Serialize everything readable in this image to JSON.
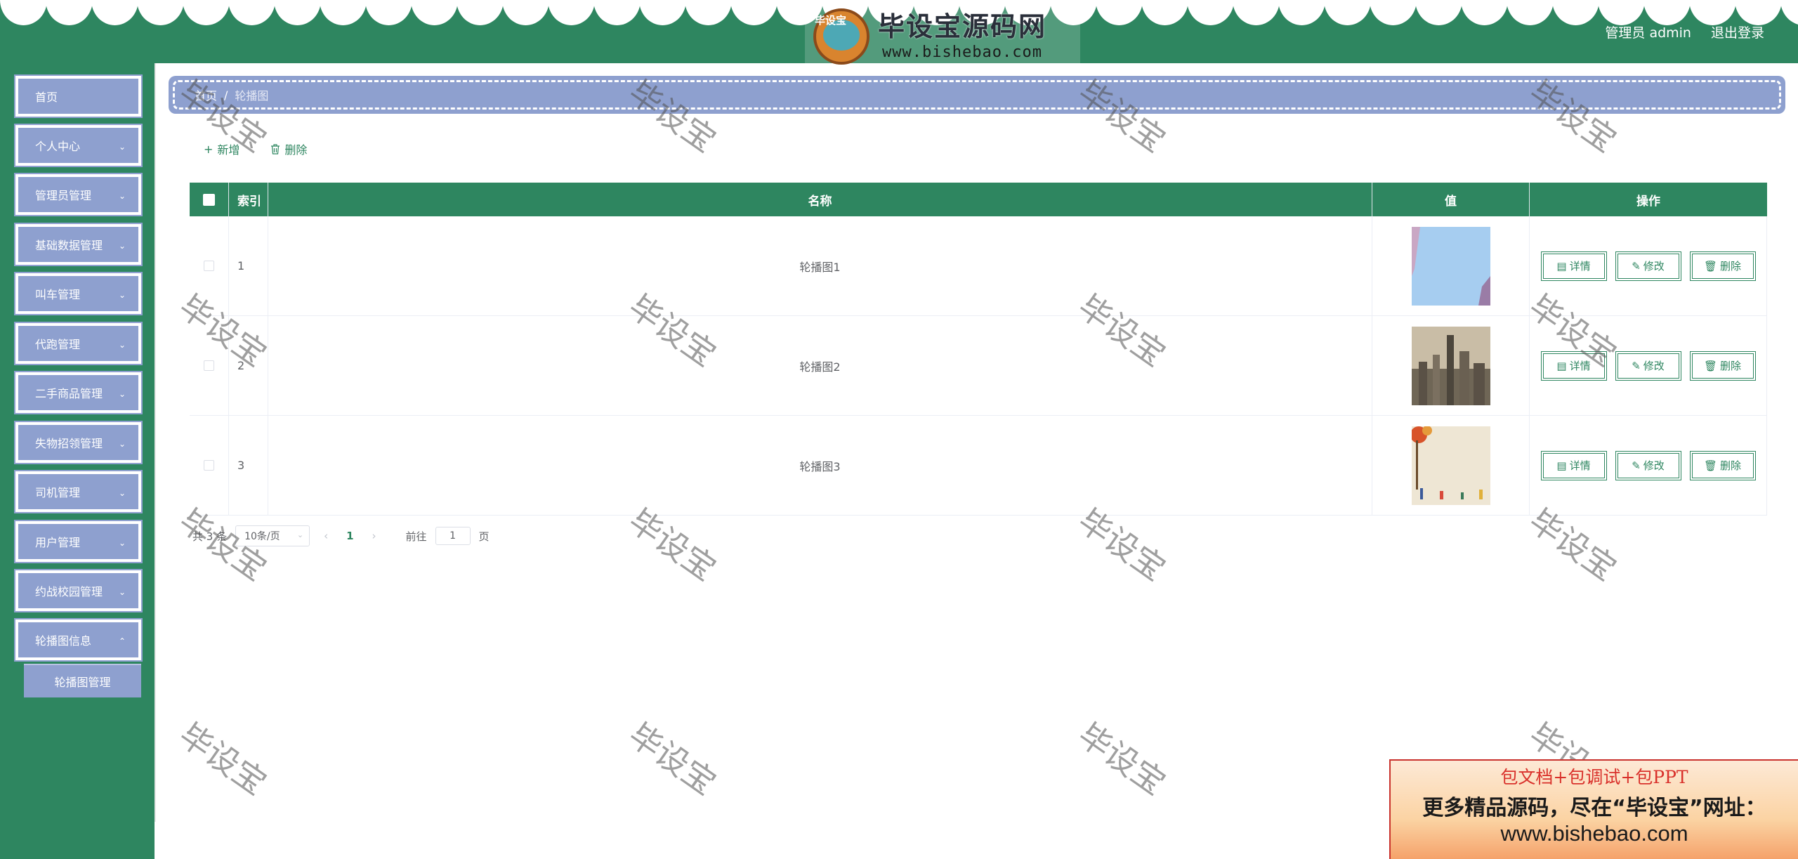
{
  "header": {
    "user_label": "管理员 admin",
    "logout_label": "退出登录",
    "logo_tag": "毕设宝",
    "logo_title": "毕设宝源码网",
    "logo_url": "www.bishebao.com",
    "bg_color": "#2e8660"
  },
  "sidebar": {
    "items": [
      {
        "label": "首页",
        "has_submenu": false
      },
      {
        "label": "个人中心",
        "has_submenu": true
      },
      {
        "label": "管理员管理",
        "has_submenu": true
      },
      {
        "label": "基础数据管理",
        "has_submenu": true
      },
      {
        "label": "叫车管理",
        "has_submenu": true
      },
      {
        "label": "代跑管理",
        "has_submenu": true
      },
      {
        "label": "二手商品管理",
        "has_submenu": true
      },
      {
        "label": "失物招领管理",
        "has_submenu": true
      },
      {
        "label": "司机管理",
        "has_submenu": true
      },
      {
        "label": "用户管理",
        "has_submenu": true
      },
      {
        "label": "约战校园管理",
        "has_submenu": true
      },
      {
        "label": "轮播图信息",
        "has_submenu": true,
        "expanded": true
      }
    ],
    "sub_item": "轮播图管理",
    "item_color": "#8ea0cf"
  },
  "breadcrumb": {
    "home": "首页",
    "separator": "/",
    "current": "轮播图"
  },
  "toolbar": {
    "add_label": "新增",
    "delete_label": "删除"
  },
  "table": {
    "headers": {
      "index": "索引",
      "name": "名称",
      "value": "值",
      "actions": "操作"
    },
    "rows": [
      {
        "index": "1",
        "name": "轮播图1",
        "image": "sky-image"
      },
      {
        "index": "2",
        "name": "轮播图2",
        "image": "city-image"
      },
      {
        "index": "3",
        "name": "轮播图3",
        "image": "autumn-image"
      }
    ],
    "actions": {
      "detail": "详情",
      "edit": "修改",
      "delete": "删除"
    }
  },
  "pagination": {
    "total_label": "共 3 条",
    "page_size": "10条/页",
    "current_page": "1",
    "goto_label": "前往",
    "goto_value": "1",
    "page_suffix": "页"
  },
  "watermark": "毕设宝",
  "ad": {
    "line1": "包文档+包调试+包PPT",
    "line2": "更多精品源码，尽在“毕设宝”网址：",
    "line3": "www.bishebao.com"
  }
}
